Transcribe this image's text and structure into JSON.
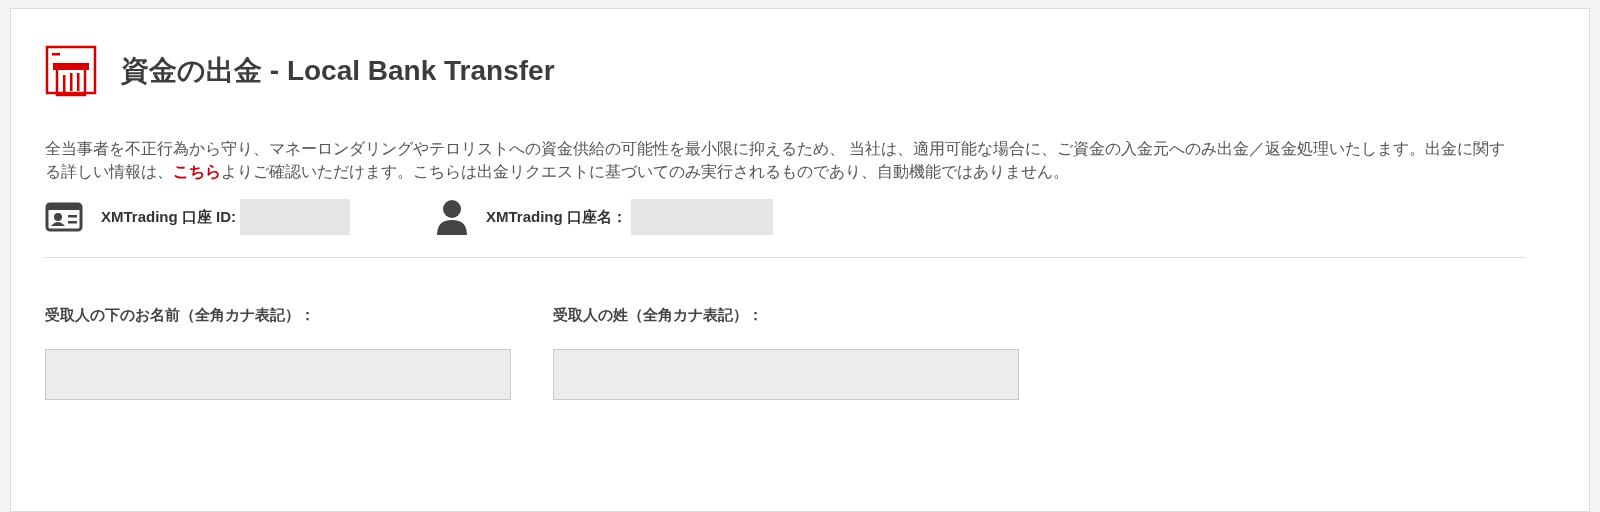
{
  "title": "資金の出金 - Local Bank Transfer",
  "notice": {
    "text_before": "全当事者を不正行為から守り、マネーロンダリングやテロリストへの資金供給の可能性を最小限に抑えるため、 当社は、適用可能な場合に、ご資金の入金元へのみ出金／返金処理いたします。出金に関する詳しい情報は、",
    "link": "こちら",
    "text_after": "よりご確認いただけます。こちらは出金リクエストに基づいてのみ実行されるものであり、自動機能ではありません。"
  },
  "account": [
    {
      "kind": "id",
      "label": "XMTrading 口座 ID:"
    },
    {
      "kind": "name",
      "label": "XMTrading 口座名："
    }
  ],
  "fields": [
    {
      "label": "受取人の下のお名前（全角カナ表記）：",
      "disabled": true
    },
    {
      "label": "受取人の姓（全角カナ表記）：",
      "disabled": true
    }
  ]
}
